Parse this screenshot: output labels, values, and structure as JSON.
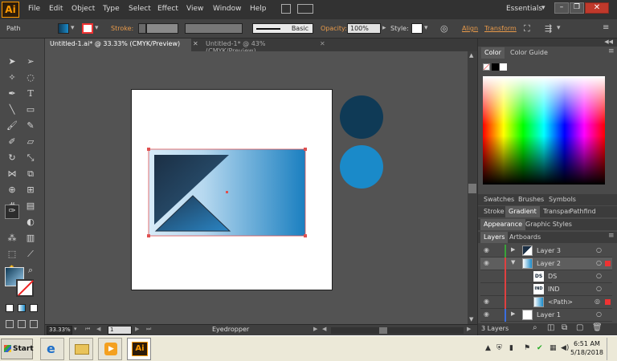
{
  "app": {
    "logo": "Ai",
    "workspace": "Essentials"
  },
  "menu": [
    "File",
    "Edit",
    "Object",
    "Type",
    "Select",
    "Effect",
    "View",
    "Window",
    "Help"
  ],
  "control": {
    "selection_label": "Path",
    "stroke_label": "Stroke:",
    "brush": "Basic",
    "opacity_label": "Opacity:",
    "opacity_value": "100%",
    "style_label": "Style:",
    "align_link": "Align",
    "transform_link": "Transform"
  },
  "tabs": [
    {
      "label": "Untitled-1.ai* @ 33.33% (CMYK/Preview)",
      "active": true
    },
    {
      "label": "Untitled-1* @ 43% (CMYK/Preview)",
      "active": false
    }
  ],
  "status": {
    "zoom": "33.33%",
    "page": "1",
    "tool": "Eyedropper"
  },
  "panels": {
    "color_tabs": [
      "Color",
      "Color Guide"
    ],
    "swatch_tabs": [
      "Swatches",
      "Brushes",
      "Symbols"
    ],
    "gradient_tabs": [
      "Stroke",
      "Gradient",
      "Transpar",
      "Pathfind"
    ],
    "appearance_tabs": [
      "Appearance",
      "Graphic Styles"
    ],
    "layer_tabs": [
      "Layers",
      "Artboards"
    ]
  },
  "layers": [
    {
      "name": "Layer 3",
      "level": 0,
      "expanded": false
    },
    {
      "name": "Layer 2",
      "level": 0,
      "expanded": true,
      "selected": true
    },
    {
      "name": "DS",
      "level": 1
    },
    {
      "name": "IND",
      "level": 1
    },
    {
      "name": "<Path>",
      "level": 1
    },
    {
      "name": "Layer 1",
      "level": 0,
      "expanded": false
    }
  ],
  "layers_count": "3 Layers",
  "taskbar": {
    "start": "Start",
    "time": "6:51 AM",
    "date": "5/18/2018"
  },
  "colors": {
    "circle_dark": "#0f3a56",
    "circle_light": "#1a8ac9",
    "accent": "#ff9a00"
  }
}
